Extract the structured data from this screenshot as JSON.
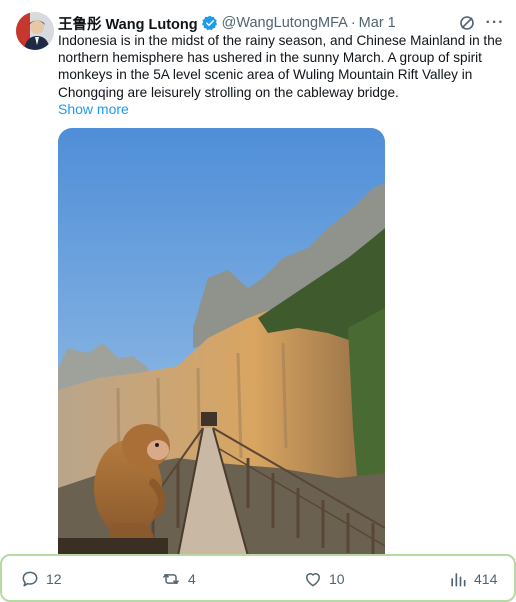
{
  "author": {
    "display_name": "王鲁彤 Wang Lutong",
    "handle": "@WangLutongMFA",
    "separator": "·",
    "date": "Mar 1",
    "avatar_icon": "avatar-photo",
    "verified_icon": "verified-badge-icon",
    "verified_color": "#1d9bf0"
  },
  "header_icons": {
    "grok": "grok-icon",
    "more": "more-options-icon",
    "more_glyph": "···"
  },
  "tweet": {
    "text": "Indonesia is in the midst of the rainy season, and Chinese Mainland in the northern hemisphere has ushered in the sunny March. A group of spirit monkeys in the 5A level scenic area of Wuling Mountain Rift Valley in Chongqing are leisurely strolling on the cableway bridge.",
    "show_more": "Show more",
    "link_color": "#1d9bf0"
  },
  "media": {
    "type": "photo",
    "scene": "photo-monkey-on-suspension-bridge"
  },
  "actions": {
    "reply": {
      "icon": "reply-icon",
      "count": "12"
    },
    "repost": {
      "icon": "repost-icon",
      "count": "4"
    },
    "like": {
      "icon": "like-icon",
      "count": "10"
    },
    "views": {
      "icon": "views-icon",
      "count": "414"
    },
    "highlight_border_color": "#b7d9a3"
  }
}
